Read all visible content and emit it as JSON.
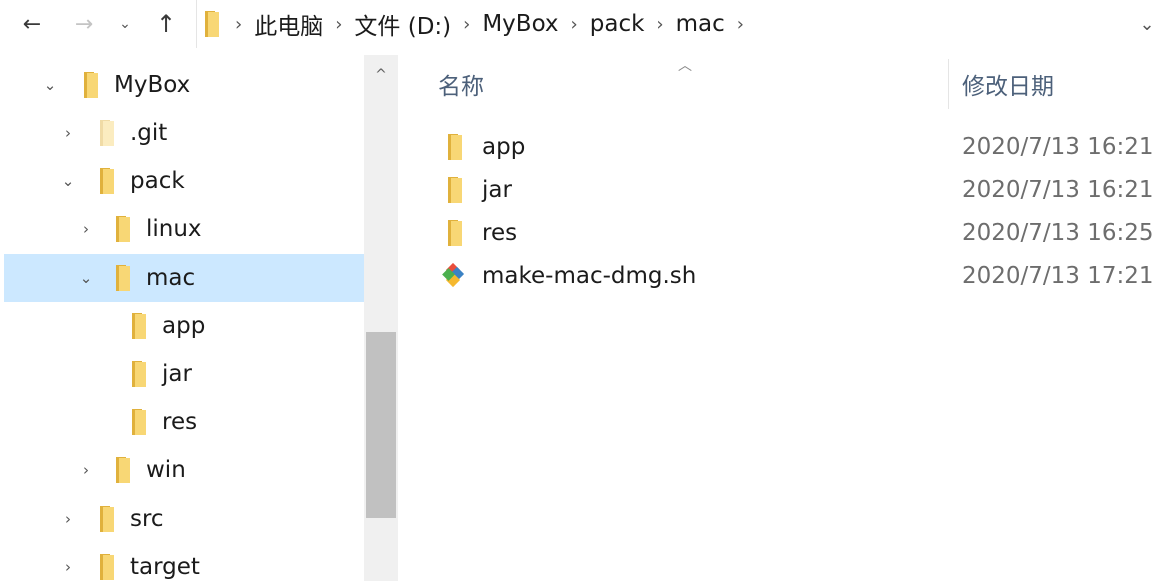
{
  "toolbar": {
    "back_glyph": "←",
    "forward_glyph": "→",
    "recent_glyph": "⌄",
    "up_glyph": "↑",
    "dropdown_glyph": "⌄"
  },
  "breadcrumb": {
    "separator": "›",
    "items": [
      "此电脑",
      "文件 (D:)",
      "MyBox",
      "pack",
      "mac"
    ]
  },
  "tree": {
    "expanded_glyph": "⌄",
    "collapsed_glyph": "›",
    "items": [
      {
        "label": "MyBox",
        "expanded": true
      },
      {
        "label": ".git",
        "expanded": false
      },
      {
        "label": "pack",
        "expanded": true
      },
      {
        "label": "linux",
        "expanded": false
      },
      {
        "label": "mac",
        "expanded": true,
        "selected": true
      },
      {
        "label": "app"
      },
      {
        "label": "jar"
      },
      {
        "label": "res"
      },
      {
        "label": "win",
        "expanded": false
      },
      {
        "label": "src",
        "expanded": false
      },
      {
        "label": "target",
        "expanded": false
      }
    ]
  },
  "columns": {
    "name": "名称",
    "date": "修改日期",
    "sort_glyph": "︿"
  },
  "files": [
    {
      "name": "app",
      "date": "2020/7/13 16:21",
      "icon": "folder-icon"
    },
    {
      "name": "jar",
      "date": "2020/7/13 16:21",
      "icon": "folder-icon"
    },
    {
      "name": "res",
      "date": "2020/7/13 16:25",
      "icon": "folder-icon"
    },
    {
      "name": "make-mac-dmg.sh",
      "date": "2020/7/13 17:21",
      "icon": "git-script-icon"
    }
  ],
  "colors": {
    "selection": "#cce8ff",
    "folder_front": "#f8d775",
    "folder_back": "#e0b13c",
    "header_text": "#4c607a"
  },
  "scroll_up_glyph": "^"
}
